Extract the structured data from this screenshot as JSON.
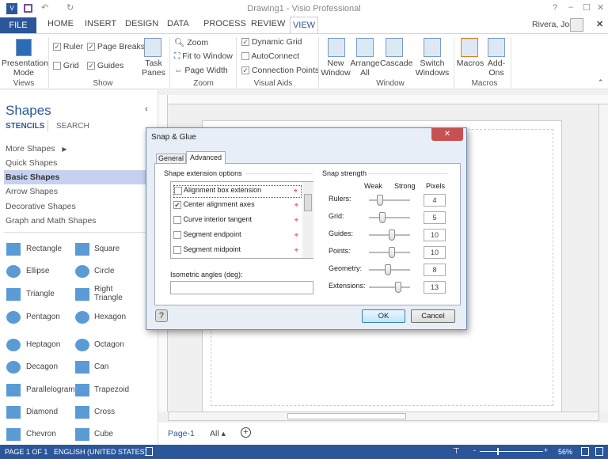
{
  "window": {
    "title": "Drawing1 - Visio Professional",
    "user": "Rivera, Jose",
    "help": "?",
    "min": "–",
    "max": "☐",
    "close": "✕",
    "ribbon_close": "✕",
    "collapse": "⌃"
  },
  "tabs": [
    "FILE",
    "HOME",
    "INSERT",
    "DESIGN",
    "DATA",
    "PROCESS",
    "REVIEW",
    "VIEW"
  ],
  "ribbon": {
    "views": {
      "presentation": "Presentation Mode",
      "label": "Views"
    },
    "show": {
      "ruler": "Ruler",
      "page_breaks": "Page Breaks",
      "grid": "Grid",
      "guides": "Guides",
      "task_panes": "Task Panes",
      "label": "Show",
      "ruler_checked": true,
      "page_breaks_checked": true,
      "grid_checked": false,
      "guides_checked": true
    },
    "zoom": {
      "zoom": "Zoom",
      "fit": "Fit to Window",
      "page_width": "Page Width",
      "label": "Zoom"
    },
    "visual_aids": {
      "dynamic_grid": "Dynamic Grid",
      "autoconnect": "AutoConnect",
      "connection_points": "Connection Points",
      "label": "Visual Aids"
    },
    "window": {
      "new": "New Window",
      "arrange": "Arrange All",
      "cascade": "Cascade",
      "switch": "Switch Windows",
      "label": "Window"
    },
    "macros": {
      "macros": "Macros",
      "addons": "Add-Ons",
      "label": "Macros"
    }
  },
  "shapes_panel": {
    "title": "Shapes",
    "stencils": "STENCILS",
    "search": "SEARCH",
    "items": [
      "More Shapes",
      "Quick Shapes",
      "Basic Shapes",
      "Arrow Shapes",
      "Decorative Shapes",
      "Graph and Math Shapes"
    ],
    "selected": "Basic Shapes",
    "shapes": [
      "Rectangle",
      "Square",
      "Ellipse",
      "Circle",
      "Triangle",
      "Right Triangle",
      "Pentagon",
      "Hexagon",
      "Heptagon",
      "Octagon",
      "Decagon",
      "Can",
      "Parallelogram",
      "Trapezoid",
      "Diamond",
      "Cross",
      "Chevron",
      "Cube"
    ]
  },
  "page_tabs": {
    "page": "Page-1",
    "all": "All"
  },
  "status": {
    "page": "PAGE 1 OF 1",
    "language": "ENGLISH (UNITED STATES)",
    "zoom": "56%",
    "zoom_minus": "-",
    "zoom_plus": "+"
  },
  "dialog": {
    "title": "Snap & Glue",
    "tabs": [
      "General",
      "Advanced"
    ],
    "active_tab": "Advanced",
    "ext_header": "Shape extension options",
    "ext_options": [
      {
        "label": "Alignment box extension",
        "checked": false
      },
      {
        "label": "Center alignment axes",
        "checked": true
      },
      {
        "label": "Curve interior tangent",
        "checked": false
      },
      {
        "label": "Segment endpoint",
        "checked": false
      },
      {
        "label": "Segment midpoint",
        "checked": false
      }
    ],
    "iso_label": "Isometric angles (deg):",
    "iso_value": "",
    "snap_header": "Snap strength",
    "weak": "Weak",
    "strong": "Strong",
    "pixels": "Pixels",
    "snap": [
      {
        "label": "Rulers:",
        "value": "4"
      },
      {
        "label": "Grid:",
        "value": "5"
      },
      {
        "label": "Guides:",
        "value": "10"
      },
      {
        "label": "Points:",
        "value": "10"
      },
      {
        "label": "Geometry:",
        "value": "8"
      },
      {
        "label": "Extensions:",
        "value": "13"
      }
    ],
    "ok": "OK",
    "cancel": "Cancel",
    "close": "✕"
  }
}
